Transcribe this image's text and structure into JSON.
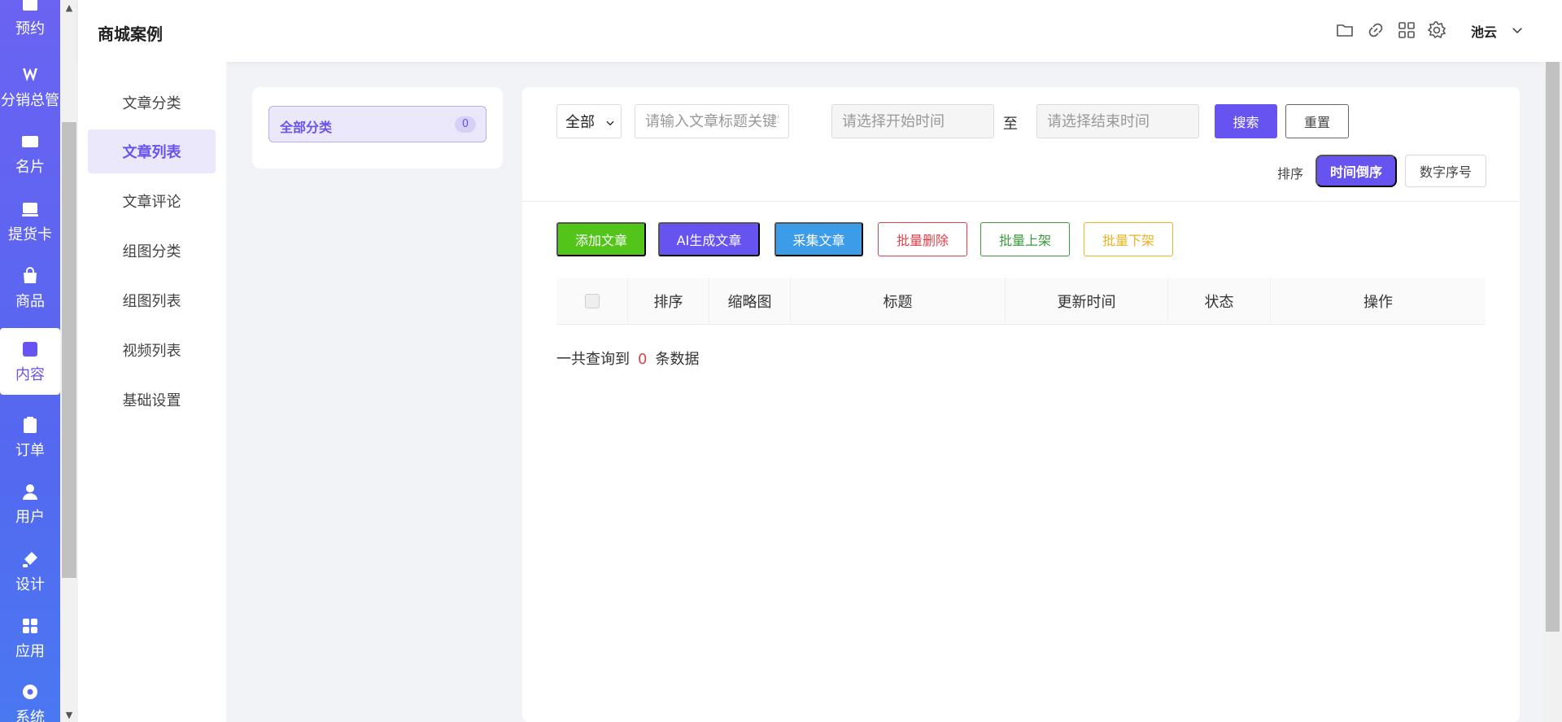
{
  "header": {
    "title": "商城案例",
    "icons": [
      "folder-icon",
      "link-icon",
      "grid-icon",
      "gear-icon"
    ],
    "user_name": "池云"
  },
  "leftnav": {
    "items": [
      {
        "label": "预约",
        "icon": "calendar-icon"
      },
      {
        "label": "分销总管",
        "icon": "distribution-icon"
      },
      {
        "label": "名片",
        "icon": "card-icon"
      },
      {
        "label": "提货卡",
        "icon": "pickup-card-icon"
      },
      {
        "label": "商品",
        "icon": "bag-icon"
      },
      {
        "label": "内容",
        "icon": "content-icon",
        "active": true
      },
      {
        "label": "订单",
        "icon": "clipboard-icon"
      },
      {
        "label": "用户",
        "icon": "user-icon"
      },
      {
        "label": "设计",
        "icon": "brush-icon"
      },
      {
        "label": "应用",
        "icon": "apps-icon"
      },
      {
        "label": "系统",
        "icon": "gear-icon"
      }
    ]
  },
  "submenu": {
    "items": [
      "文章分类",
      "文章列表",
      "文章评论",
      "组图分类",
      "组图列表",
      "视频列表",
      "基础设置"
    ],
    "active_index": 1
  },
  "category": {
    "all_label": "全部分类",
    "all_count": "0"
  },
  "filters": {
    "status_value": "全部",
    "keyword_placeholder": "请输入文章标题关键字",
    "start_placeholder": "请选择开始时间",
    "to_label": "至",
    "end_placeholder": "请选择结束时间",
    "search_label": "搜索",
    "reset_label": "重置"
  },
  "sort": {
    "label": "排序",
    "time_desc": "时间倒序",
    "number_order": "数字序号"
  },
  "actions": {
    "add": "添加文章",
    "ai": "AI生成文章",
    "collect": "采集文章",
    "batch_delete": "批量删除",
    "batch_on": "批量上架",
    "batch_off": "批量下架"
  },
  "table": {
    "columns": [
      "排序",
      "缩略图",
      "标题",
      "更新时间",
      "状态",
      "操作"
    ]
  },
  "result": {
    "prefix": "一共查询到",
    "count": "0",
    "suffix": "条数据"
  },
  "colors": {
    "primary": "#6753f0",
    "success": "#52c41a",
    "info": "#3d9ce8",
    "danger": "#e0414b",
    "warning": "#e8b423"
  }
}
